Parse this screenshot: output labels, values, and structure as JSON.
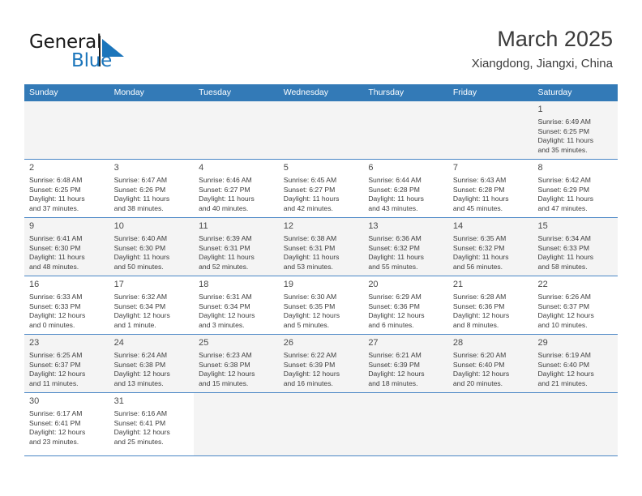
{
  "brand": {
    "name_top": "General",
    "name_bottom": "Blue",
    "mark": "triangle-logo-icon",
    "color_primary": "#1b75bb",
    "color_text": "#1a1a1a"
  },
  "header": {
    "title": "March 2025",
    "subtitle": "Xiangdong, Jiangxi, China"
  },
  "theme": {
    "header_row_bg": "#337ab7",
    "header_row_text": "#ffffff",
    "row_divider": "#4a86c5",
    "cell_shaded_bg": "#f4f4f4"
  },
  "weekdays": [
    "Sunday",
    "Monday",
    "Tuesday",
    "Wednesday",
    "Thursday",
    "Friday",
    "Saturday"
  ],
  "labels": {
    "sunrise_prefix": "Sunrise:",
    "sunset_prefix": "Sunset:",
    "daylight_prefix": "Daylight:"
  },
  "weeks": [
    [
      {
        "day": "",
        "empty": true
      },
      {
        "day": "",
        "empty": true
      },
      {
        "day": "",
        "empty": true
      },
      {
        "day": "",
        "empty": true
      },
      {
        "day": "",
        "empty": true
      },
      {
        "day": "",
        "empty": true
      },
      {
        "day": "1",
        "sunrise": "Sunrise: 6:49 AM",
        "sunset": "Sunset: 6:25 PM",
        "daylight_1": "Daylight: 11 hours",
        "daylight_2": "and 35 minutes."
      }
    ],
    [
      {
        "day": "2",
        "sunrise": "Sunrise: 6:48 AM",
        "sunset": "Sunset: 6:25 PM",
        "daylight_1": "Daylight: 11 hours",
        "daylight_2": "and 37 minutes."
      },
      {
        "day": "3",
        "sunrise": "Sunrise: 6:47 AM",
        "sunset": "Sunset: 6:26 PM",
        "daylight_1": "Daylight: 11 hours",
        "daylight_2": "and 38 minutes."
      },
      {
        "day": "4",
        "sunrise": "Sunrise: 6:46 AM",
        "sunset": "Sunset: 6:27 PM",
        "daylight_1": "Daylight: 11 hours",
        "daylight_2": "and 40 minutes."
      },
      {
        "day": "5",
        "sunrise": "Sunrise: 6:45 AM",
        "sunset": "Sunset: 6:27 PM",
        "daylight_1": "Daylight: 11 hours",
        "daylight_2": "and 42 minutes."
      },
      {
        "day": "6",
        "sunrise": "Sunrise: 6:44 AM",
        "sunset": "Sunset: 6:28 PM",
        "daylight_1": "Daylight: 11 hours",
        "daylight_2": "and 43 minutes."
      },
      {
        "day": "7",
        "sunrise": "Sunrise: 6:43 AM",
        "sunset": "Sunset: 6:28 PM",
        "daylight_1": "Daylight: 11 hours",
        "daylight_2": "and 45 minutes."
      },
      {
        "day": "8",
        "sunrise": "Sunrise: 6:42 AM",
        "sunset": "Sunset: 6:29 PM",
        "daylight_1": "Daylight: 11 hours",
        "daylight_2": "and 47 minutes."
      }
    ],
    [
      {
        "day": "9",
        "sunrise": "Sunrise: 6:41 AM",
        "sunset": "Sunset: 6:30 PM",
        "daylight_1": "Daylight: 11 hours",
        "daylight_2": "and 48 minutes."
      },
      {
        "day": "10",
        "sunrise": "Sunrise: 6:40 AM",
        "sunset": "Sunset: 6:30 PM",
        "daylight_1": "Daylight: 11 hours",
        "daylight_2": "and 50 minutes."
      },
      {
        "day": "11",
        "sunrise": "Sunrise: 6:39 AM",
        "sunset": "Sunset: 6:31 PM",
        "daylight_1": "Daylight: 11 hours",
        "daylight_2": "and 52 minutes."
      },
      {
        "day": "12",
        "sunrise": "Sunrise: 6:38 AM",
        "sunset": "Sunset: 6:31 PM",
        "daylight_1": "Daylight: 11 hours",
        "daylight_2": "and 53 minutes."
      },
      {
        "day": "13",
        "sunrise": "Sunrise: 6:36 AM",
        "sunset": "Sunset: 6:32 PM",
        "daylight_1": "Daylight: 11 hours",
        "daylight_2": "and 55 minutes."
      },
      {
        "day": "14",
        "sunrise": "Sunrise: 6:35 AM",
        "sunset": "Sunset: 6:32 PM",
        "daylight_1": "Daylight: 11 hours",
        "daylight_2": "and 56 minutes."
      },
      {
        "day": "15",
        "sunrise": "Sunrise: 6:34 AM",
        "sunset": "Sunset: 6:33 PM",
        "daylight_1": "Daylight: 11 hours",
        "daylight_2": "and 58 minutes."
      }
    ],
    [
      {
        "day": "16",
        "sunrise": "Sunrise: 6:33 AM",
        "sunset": "Sunset: 6:33 PM",
        "daylight_1": "Daylight: 12 hours",
        "daylight_2": "and 0 minutes."
      },
      {
        "day": "17",
        "sunrise": "Sunrise: 6:32 AM",
        "sunset": "Sunset: 6:34 PM",
        "daylight_1": "Daylight: 12 hours",
        "daylight_2": "and 1 minute."
      },
      {
        "day": "18",
        "sunrise": "Sunrise: 6:31 AM",
        "sunset": "Sunset: 6:34 PM",
        "daylight_1": "Daylight: 12 hours",
        "daylight_2": "and 3 minutes."
      },
      {
        "day": "19",
        "sunrise": "Sunrise: 6:30 AM",
        "sunset": "Sunset: 6:35 PM",
        "daylight_1": "Daylight: 12 hours",
        "daylight_2": "and 5 minutes."
      },
      {
        "day": "20",
        "sunrise": "Sunrise: 6:29 AM",
        "sunset": "Sunset: 6:36 PM",
        "daylight_1": "Daylight: 12 hours",
        "daylight_2": "and 6 minutes."
      },
      {
        "day": "21",
        "sunrise": "Sunrise: 6:28 AM",
        "sunset": "Sunset: 6:36 PM",
        "daylight_1": "Daylight: 12 hours",
        "daylight_2": "and 8 minutes."
      },
      {
        "day": "22",
        "sunrise": "Sunrise: 6:26 AM",
        "sunset": "Sunset: 6:37 PM",
        "daylight_1": "Daylight: 12 hours",
        "daylight_2": "and 10 minutes."
      }
    ],
    [
      {
        "day": "23",
        "sunrise": "Sunrise: 6:25 AM",
        "sunset": "Sunset: 6:37 PM",
        "daylight_1": "Daylight: 12 hours",
        "daylight_2": "and 11 minutes."
      },
      {
        "day": "24",
        "sunrise": "Sunrise: 6:24 AM",
        "sunset": "Sunset: 6:38 PM",
        "daylight_1": "Daylight: 12 hours",
        "daylight_2": "and 13 minutes."
      },
      {
        "day": "25",
        "sunrise": "Sunrise: 6:23 AM",
        "sunset": "Sunset: 6:38 PM",
        "daylight_1": "Daylight: 12 hours",
        "daylight_2": "and 15 minutes."
      },
      {
        "day": "26",
        "sunrise": "Sunrise: 6:22 AM",
        "sunset": "Sunset: 6:39 PM",
        "daylight_1": "Daylight: 12 hours",
        "daylight_2": "and 16 minutes."
      },
      {
        "day": "27",
        "sunrise": "Sunrise: 6:21 AM",
        "sunset": "Sunset: 6:39 PM",
        "daylight_1": "Daylight: 12 hours",
        "daylight_2": "and 18 minutes."
      },
      {
        "day": "28",
        "sunrise": "Sunrise: 6:20 AM",
        "sunset": "Sunset: 6:40 PM",
        "daylight_1": "Daylight: 12 hours",
        "daylight_2": "and 20 minutes."
      },
      {
        "day": "29",
        "sunrise": "Sunrise: 6:19 AM",
        "sunset": "Sunset: 6:40 PM",
        "daylight_1": "Daylight: 12 hours",
        "daylight_2": "and 21 minutes."
      }
    ],
    [
      {
        "day": "30",
        "sunrise": "Sunrise: 6:17 AM",
        "sunset": "Sunset: 6:41 PM",
        "daylight_1": "Daylight: 12 hours",
        "daylight_2": "and 23 minutes."
      },
      {
        "day": "31",
        "sunrise": "Sunrise: 6:16 AM",
        "sunset": "Sunset: 6:41 PM",
        "daylight_1": "Daylight: 12 hours",
        "daylight_2": "and 25 minutes."
      },
      {
        "day": "",
        "empty": true
      },
      {
        "day": "",
        "empty": true
      },
      {
        "day": "",
        "empty": true
      },
      {
        "day": "",
        "empty": true
      },
      {
        "day": "",
        "empty": true
      }
    ]
  ]
}
